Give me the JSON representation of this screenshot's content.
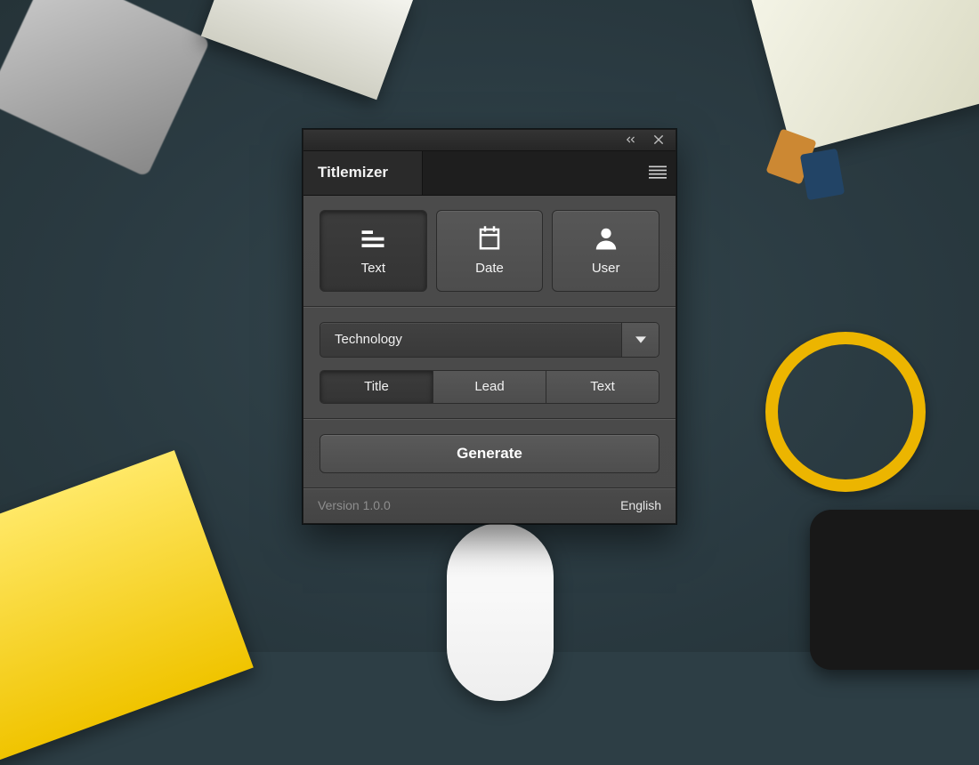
{
  "app": {
    "title": "Titlemizer"
  },
  "types": {
    "items": [
      {
        "label": "Text",
        "icon": "text-icon",
        "active": true
      },
      {
        "label": "Date",
        "icon": "calendar-icon",
        "active": false
      },
      {
        "label": "User",
        "icon": "user-icon",
        "active": false
      }
    ]
  },
  "category": {
    "selected": "Technology"
  },
  "segments": {
    "items": [
      {
        "label": "Title",
        "active": true
      },
      {
        "label": "Lead",
        "active": false
      },
      {
        "label": "Text",
        "active": false
      }
    ]
  },
  "actions": {
    "generate_label": "Generate"
  },
  "footer": {
    "version": "Version 1.0.0",
    "language": "English"
  }
}
